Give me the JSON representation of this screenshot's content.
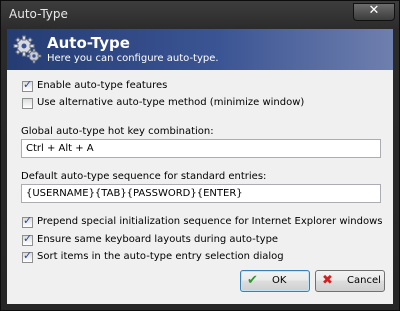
{
  "window": {
    "title": "Auto-Type",
    "close_glyph": "✕"
  },
  "banner": {
    "icon": "gears-icon",
    "title": "Auto-Type",
    "subtitle": "Here you can configure auto-type.",
    "colors": {
      "start": "#253c73",
      "end": "#6f7fae"
    }
  },
  "options": {
    "enable": {
      "label": "Enable auto-type features",
      "checked": true
    },
    "alternative": {
      "label": "Use alternative auto-type method (minimize window)",
      "checked": false
    }
  },
  "hotkey": {
    "label": "Global auto-type hot key combination:",
    "value": "Ctrl + Alt + A"
  },
  "sequence": {
    "label": "Default auto-type sequence for standard entries:",
    "value": "{USERNAME}{TAB}{PASSWORD}{ENTER}"
  },
  "advanced": {
    "prepend": {
      "label": "Prepend special initialization sequence for Internet Explorer windows",
      "checked": true
    },
    "same_layout": {
      "label": "Ensure same keyboard layouts during auto-type",
      "checked": true
    },
    "sort_items": {
      "label": "Sort items in the auto-type entry selection dialog",
      "checked": true
    }
  },
  "buttons": {
    "ok": {
      "label": "OK",
      "icon": "green-check-icon"
    },
    "cancel": {
      "label": "Cancel",
      "icon": "red-cross-icon"
    }
  }
}
